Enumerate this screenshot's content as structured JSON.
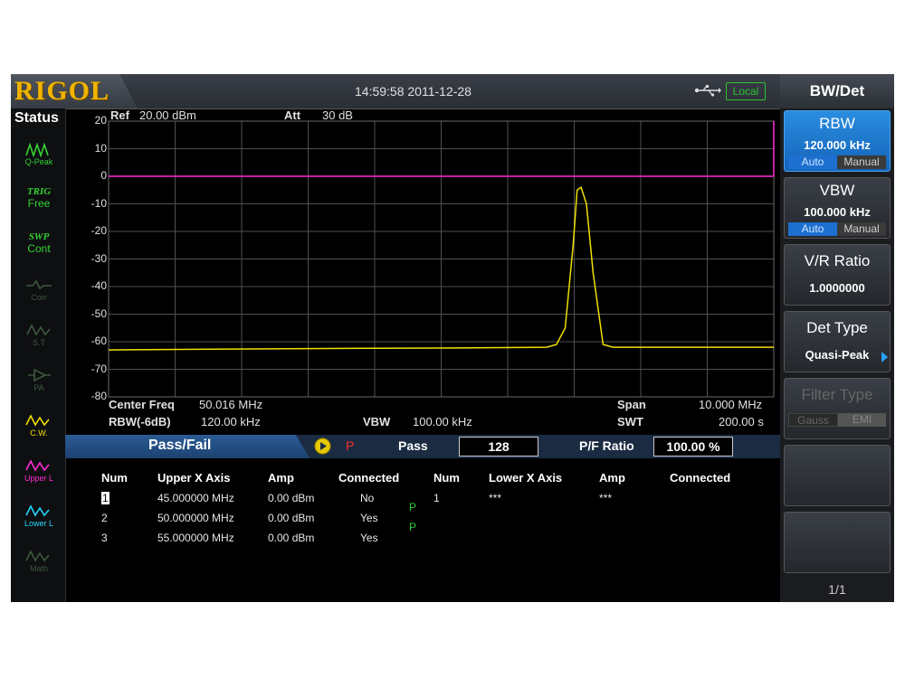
{
  "logo": "RIGOL",
  "datetime": "14:59:58 2011-12-28",
  "remote_status": "Local",
  "status_panel": {
    "title": "Status",
    "items": [
      {
        "line1": "",
        "line2": "",
        "line3": "Q-Peak",
        "color": "#35d235",
        "icon": "qpeak-icon"
      },
      {
        "line1": "TRIG",
        "line2": "Free",
        "line3": "",
        "color": "#35d235",
        "icon": ""
      },
      {
        "line1": "SWP",
        "line2": "Cont",
        "line3": "",
        "color": "#35d235",
        "icon": ""
      },
      {
        "line1": "",
        "line2": "",
        "line3": "Corr",
        "color": "#3d5a3d",
        "icon": "corr-icon"
      },
      {
        "line1": "",
        "line2": "",
        "line3": "S.T",
        "color": "#3d5a3d",
        "icon": "st-icon"
      },
      {
        "line1": "",
        "line2": "",
        "line3": "PA",
        "color": "#3d5a3d",
        "icon": "pa-icon"
      },
      {
        "line1": "",
        "line2": "",
        "line3": "C.W.",
        "color": "#f0e000",
        "icon": "cw-icon"
      },
      {
        "line1": "",
        "line2": "",
        "line3": "Upper L",
        "color": "#ff2cd8",
        "icon": "upper-limit-icon"
      },
      {
        "line1": "",
        "line2": "",
        "line3": "Lower L",
        "color": "#20d8ff",
        "icon": "lower-limit-icon"
      },
      {
        "line1": "",
        "line2": "",
        "line3": "Math",
        "color": "#3d5a3d",
        "icon": "math-icon"
      }
    ]
  },
  "header": {
    "ref_label": "Ref",
    "ref_value": "20.00 dBm",
    "att_label": "Att",
    "att_value": "30 dB"
  },
  "footer": {
    "center_freq_label": "Center Freq",
    "center_freq_value": "50.016 MHz",
    "rbw_label": "RBW(-6dB)",
    "rbw_value": "120.00 kHz",
    "vbw_label": "VBW",
    "vbw_value": "100.00 kHz",
    "span_label": "Span",
    "span_value": "10.000 MHz",
    "swt_label": "SWT",
    "swt_value": "200.00 s"
  },
  "chart_data": {
    "type": "line",
    "y_tick_labels": [
      "20",
      "10",
      "0",
      "-10",
      "-20",
      "-30",
      "-40",
      "-50",
      "-60",
      "-70",
      "-80"
    ],
    "ylim": [
      -80,
      20
    ],
    "xlim": [
      45.016,
      55.016
    ],
    "x_unit": "MHz",
    "grid": true,
    "series": [
      {
        "color": "#f0e000",
        "x": [
          45.016,
          48.0,
          50.016,
          51.6,
          51.75,
          51.88,
          52.0,
          52.06,
          52.12,
          52.2,
          52.3,
          52.45,
          52.6,
          55.016
        ],
        "y": [
          -63,
          -62.5,
          -62.3,
          -62,
          -61,
          -55,
          -25,
          -5,
          -4,
          -10,
          -35,
          -61,
          -62,
          -62
        ]
      },
      {
        "color": "#ff2cd8",
        "x": [
          45.016,
          55.016
        ],
        "y": [
          0,
          0
        ]
      }
    ]
  },
  "passfail": {
    "title": "Pass/Fail",
    "state_letter": "P",
    "pass_label": "Pass",
    "pass_count": "128",
    "ratio_label": "P/F Ratio",
    "ratio_value": "100.00 %"
  },
  "table": {
    "upper_headers": [
      "Num",
      "Upper X Axis",
      "Amp",
      "Connected"
    ],
    "lower_headers": [
      "Num",
      "Lower X Axis",
      "Amp",
      "Connected"
    ],
    "upper_rows": [
      {
        "num": "1",
        "x": "45.000000 MHz",
        "amp": "0.00 dBm",
        "connected": "No"
      },
      {
        "num": "2",
        "x": "50.000000 MHz",
        "amp": "0.00 dBm",
        "connected": "Yes"
      },
      {
        "num": "3",
        "x": "55.000000 MHz",
        "amp": "0.00 dBm",
        "connected": "Yes"
      }
    ],
    "pass_marks": [
      "P",
      "P"
    ],
    "lower_rows": [
      {
        "num": "1",
        "x": "***",
        "amp": "***",
        "connected": ""
      }
    ]
  },
  "softmenu": {
    "title": "BW/Det",
    "rbw": {
      "label": "RBW",
      "value": "120.000 kHz",
      "auto": "Auto",
      "manual": "Manual"
    },
    "vbw": {
      "label": "VBW",
      "value": "100.000 kHz",
      "auto": "Auto",
      "manual": "Manual"
    },
    "vr_ratio": {
      "label": "V/R Ratio",
      "value": "1.0000000"
    },
    "det_type": {
      "label": "Det Type",
      "value": "Quasi-Peak"
    },
    "filter_type": {
      "label": "Filter Type",
      "gauss": "Gauss",
      "emi": "EMI"
    },
    "page": "1/1"
  }
}
